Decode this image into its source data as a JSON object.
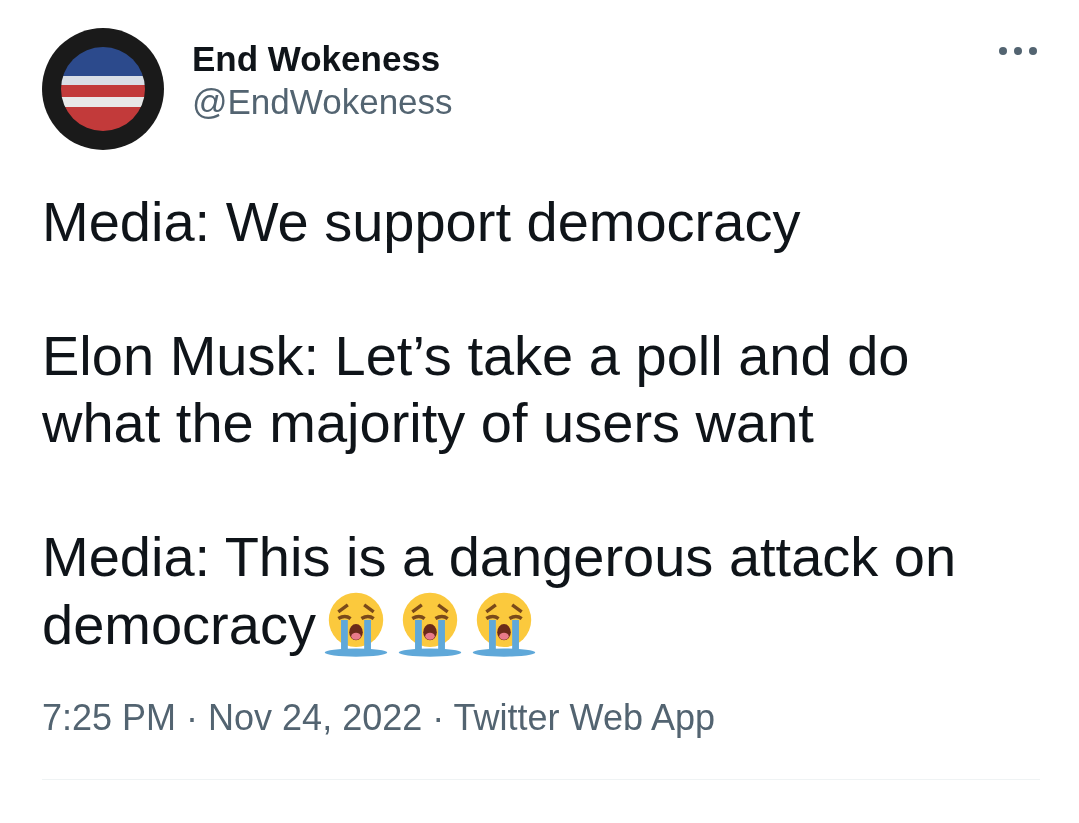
{
  "author": {
    "name": "End Wokeness",
    "handle": "@EndWokeness"
  },
  "tweet": {
    "paragraphs": [
      {
        "lines": [
          "Media: We support democracy"
        ]
      },
      {
        "lines": [
          "Elon Musk: Let’s take a poll and do",
          "what the majority of users want"
        ]
      },
      {
        "lines": [
          "Media: This is a dangerous attack on",
          "democracy"
        ],
        "icons": [
          {
            "kind": "crying-face"
          },
          {
            "kind": "crying-face"
          },
          {
            "kind": "crying-face"
          }
        ]
      }
    ]
  },
  "meta": "7:25 PM · Nov 24, 2022 · Twitter Web App"
}
